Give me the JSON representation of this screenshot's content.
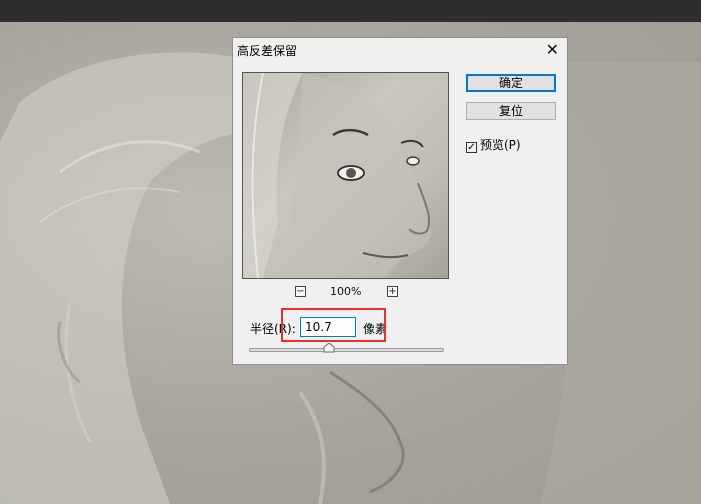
{
  "dialog": {
    "title": "高反差保留",
    "close_glyph": "✕",
    "ok_label": "确定",
    "reset_label": "复位",
    "preview_checkbox": {
      "label": "预览(P)",
      "checked": true,
      "check_glyph": "✓"
    },
    "zoom": {
      "minus": "−",
      "plus": "+",
      "level": "100%"
    },
    "radius": {
      "label": "半径(R):",
      "value": "10.7",
      "unit": "像素",
      "slider_fraction": 0.41
    }
  },
  "colors": {
    "highlight": "#e8322f",
    "focus": "#0078d7"
  }
}
